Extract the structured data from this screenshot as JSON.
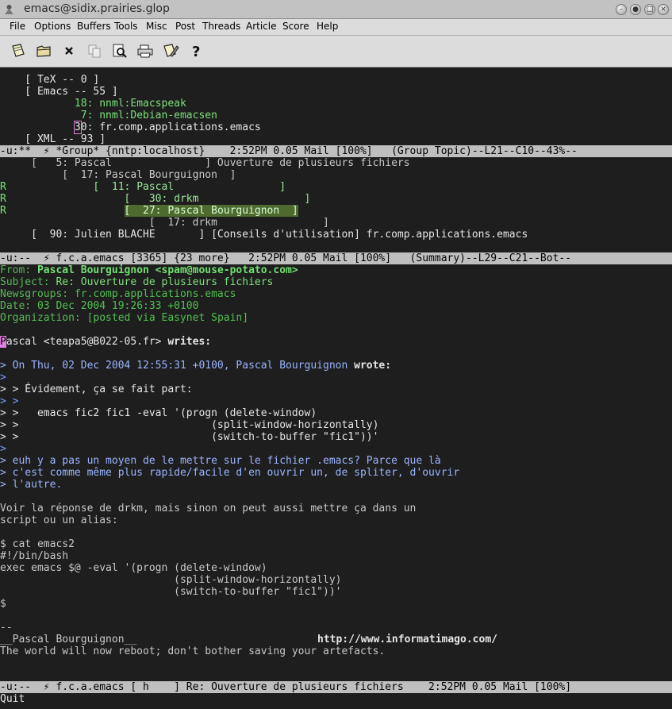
{
  "window": {
    "title": "emacs@sidix.prairies.glop"
  },
  "menu": [
    "File",
    "Options",
    "Buffers",
    "Tools",
    "Misc",
    "Post",
    "Threads",
    "Article",
    "Score",
    "Help"
  ],
  "toolbar": [
    "open-icon",
    "folder-icon",
    "close-icon",
    "copy-icon",
    "search-icon",
    "print-icon",
    "edit-icon",
    "help-icon"
  ],
  "group": {
    "tex": "    [ TeX -- 0 ]",
    "emacs": "    [ Emacs -- 55 ]",
    "g1_num": "            18:",
    "g1_name": " nnml:Emacspeak",
    "g2_num": "             7:",
    "g2_name": " nnml:Debian-emacsen",
    "g3_pre": "            ",
    "g3_cursor": "3",
    "g3_num": "0:",
    "g3_name": " fr.comp.applications.emacs",
    "xml": "    [ XML -- 93 ]"
  },
  "modeline1": "-u:**  ⚡ *Group* {nntp:localhost}    2:52PM 0.05 Mail [100%]   (Group Topic)--L21--C10--43%--",
  "summary": {
    "r1": "     [   5: Pascal               ] Ouverture de plusieurs fichiers",
    "r2": "          [  17: Pascal Bourguignon  ]",
    "r3_mark": "R",
    "r3": "              [  11: Pascal                 ]",
    "r4_mark": "R",
    "r4": "                   [   30: drkm                 ]",
    "r5_mark": "R",
    "r5_pre": "                   ",
    "r5_hl": "[  27: Pascal Bourguignon  ]",
    "r6": "                        [  17: drkm                 ]",
    "r7": "     [  90: Julien BLACHE       ] [Conseils d'utilisation] fr.comp.applications.emacs"
  },
  "modeline2": "-u:--  ⚡ f.c.a.emacs [3365] {23 more}   2:52PM 0.05 Mail [100%]   (Summary)--L29--C21--Bot--",
  "article": {
    "from_label": "From: ",
    "from_value": "Pascal Bourguignon <spam@mouse-potato.com>",
    "subject_label": "Subject: ",
    "subject_value": "Re: Ouverture de plusieurs fichiers",
    "newsgroups_label": "Newsgroups: ",
    "newsgroups_value": "fr.comp.applications.emacs",
    "date_label": "Date: ",
    "date_value": "03 Dec 2004 19:26:33 +0100",
    "org_label": "Organization: ",
    "org_value": "[posted via Easynet Spain]",
    "attr_cursor": "P",
    "attr_rest": "ascal <teapa5@B022-05.fr> ",
    "attr_writes": "writes:",
    "q1": "> On Thu, 02 Dec 2004 12:55:31 +0100, Pascal Bourguignon ",
    "q1_wrote": "wrote:",
    "q2": ">",
    "q3": "> > Évidement, ça se fait part:",
    "q4": "> >",
    "q5": "> >   emacs fic2 fic1 -eval '(progn (delete-window)",
    "q6": "> >                               (split-window-horizontally)",
    "q7": "> >                               (switch-to-buffer \"fic1\"))'",
    "q8": ">",
    "q9": "> euh y a pas un moyen de le mettre sur le fichier .emacs? Parce que là",
    "q10": "> c'est comme même plus rapide/facile d'en ouvrir un, de spliter, d'ouvrir",
    "q11": "> l'autre.",
    "b1": "Voir la réponse de drkm, mais sinon on peut aussi mettre ça dans un",
    "b2": "script ou un alias:",
    "c1": "$ cat emacs2",
    "c2": "#!/bin/bash",
    "c3": "exec emacs $@ -eval '(progn (delete-window)",
    "c4": "                            (split-window-horizontally)",
    "c5": "                            (switch-to-buffer \"fic1\"))'",
    "c6": "$",
    "s1": "--",
    "s2": "__Pascal Bourguignon__",
    "s2_url": "http://www.informatimago.com/",
    "s3": "The world will now reboot; don't bother saving your artefacts."
  },
  "modeline3": "-u:--  ⚡ f.c.a.emacs [ h    ] Re: Ouverture de plusieurs fichiers    2:52PM 0.05 Mail [100%]",
  "minibuffer": "Quit"
}
